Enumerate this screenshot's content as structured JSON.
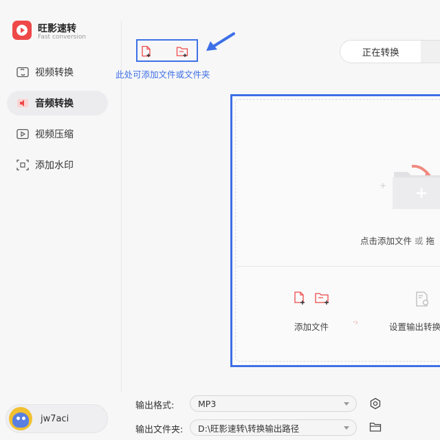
{
  "app": {
    "name": "旺影速转",
    "subtitle": "Fast conversion"
  },
  "sidebar": {
    "items": [
      {
        "label": "视频转换",
        "icon": "video-convert-icon",
        "active": false
      },
      {
        "label": "音频转换",
        "icon": "audio-convert-icon",
        "active": true
      },
      {
        "label": "视频压缩",
        "icon": "video-compress-icon",
        "active": false
      },
      {
        "label": "添加水印",
        "icon": "watermark-icon",
        "active": false
      }
    ],
    "user": {
      "name": "jw7aci"
    }
  },
  "toolbar": {
    "add_file_icon": "add-file-icon",
    "add_folder_icon": "add-folder-icon",
    "hint": "此处可添加文件或文件夹"
  },
  "tabs": [
    {
      "label": "正在转换"
    },
    {
      "label": ""
    }
  ],
  "dropzone": {
    "text_a": "点击添加文件",
    "text_or": "或",
    "text_b": "拖",
    "steps": [
      {
        "label": "添加文件"
      },
      {
        "label": "设置输出转换"
      }
    ]
  },
  "output": {
    "format_label": "输出格式:",
    "format_value": "MP3",
    "folder_label": "输出文件夹:",
    "folder_value": "D:\\旺影速转\\转换输出路径"
  },
  "colors": {
    "accent": "#ef4848",
    "highlight": "#3d6fe6"
  }
}
